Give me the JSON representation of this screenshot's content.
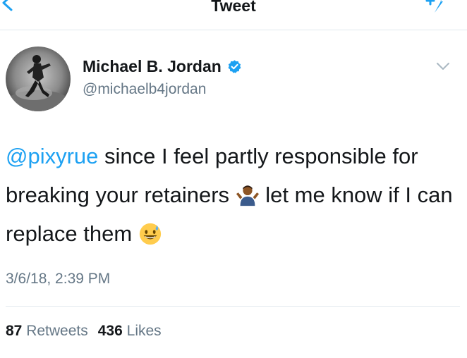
{
  "header": {
    "title": "Tweet",
    "back_icon": "chevron-left-icon",
    "compose_icon": "compose-tweet-icon"
  },
  "author": {
    "display_name": "Michael B. Jordan",
    "handle": "@michaelb4jordan",
    "verified": true
  },
  "tweet": {
    "mention": "@pixyrue",
    "text_part1": " since I feel partly responsible for breaking your retainers ",
    "emoji1": "person-shrugging-emoji",
    "text_part2": " let me know if I can replace them ",
    "emoji2": "grinning-face-with-sweat-emoji",
    "timestamp": "3/6/18, 2:39 PM"
  },
  "stats": {
    "retweets_count": "87",
    "retweets_label": "Retweets",
    "likes_count": "436",
    "likes_label": "Likes"
  },
  "colors": {
    "accent": "#1da1f2",
    "text": "#14171a",
    "secondary": "#657786",
    "divider": "#e1e8ed"
  }
}
